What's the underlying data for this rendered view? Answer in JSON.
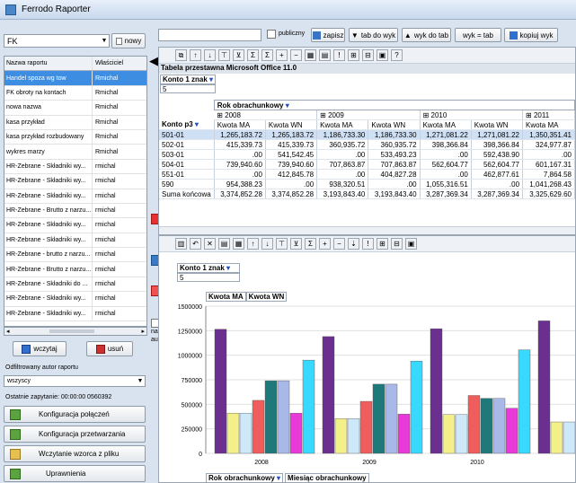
{
  "app": {
    "title": "Ferrodo Raporter"
  },
  "left": {
    "filter_value": "FK",
    "new_button": "nowy",
    "table": {
      "headers": [
        "Nazwa raportu",
        "Właściciel"
      ],
      "rows": [
        [
          "Handel spoza wg tow",
          "Rmichal"
        ],
        [
          "FK obroty na kontach",
          "Rmichal"
        ],
        [
          "nowa nazwa",
          "Rmichal"
        ],
        [
          "kasa przykład",
          "Rmichal"
        ],
        [
          "kasa przykład rozbudowany",
          "Rmichal"
        ],
        [
          "wykres marzy",
          "Rmichal"
        ],
        [
          "HR-Zebrane - Składniki wy...",
          "rmichal"
        ],
        [
          "HR-Zebrane - Składniki wy...",
          "rmichal"
        ],
        [
          "HR-Zebrane - Składniki wy...",
          "rmichal"
        ],
        [
          "HR-Zebrane - Brutto z narzu...",
          "rmichal"
        ],
        [
          "HR-Zebrane - Składniki wy...",
          "rmichal"
        ],
        [
          "HR-Zebrane - Składniki wy...",
          "rmichal"
        ],
        [
          "HR-Zebrane - brutto z narzu...",
          "rmichal"
        ],
        [
          "HR-Zebrane - Brutto z narzu...",
          "rmichal"
        ],
        [
          "HR-Zebrane - Składniki do ...",
          "rmichal"
        ],
        [
          "HR-Zebrane - Składniki wy...",
          "rmichal"
        ],
        [
          "HR-Zebrane - Składniki wy...",
          "rmichal"
        ]
      ]
    },
    "load_button": "wczytaj",
    "delete_button": "usuń",
    "filter_author_label": "Odfiltrowany autor raportu",
    "author_value": "wszyscy",
    "last_query": "Ostatnie zapytanie: 00:00:00 0560392",
    "buttons": [
      "Konfiguracja połączeń",
      "Konfiguracja przetwarzania",
      "Wczytanie wzorca z pliku",
      "Uprawnienia"
    ]
  },
  "side": {
    "nag_label": "nag",
    "auto_label": "auto"
  },
  "toolbar": {
    "publiczny": "publiczny",
    "zapisz": "zapisz",
    "tab_do_wyk": "tab do wyk",
    "wyk_do_tab": "wyk do tab",
    "wyk_tab": "wyk = tab",
    "kopiuj_wyk": "kopiuj wyk"
  },
  "pivot": {
    "title": "Tabela przestawna Microsoft Office 11.0",
    "konto1": "Konto 1 znak",
    "konto1_val": "5",
    "rok_header": "Rok obrachunkowy",
    "konto3_label": "Konto p3",
    "years": [
      "⊞ 2008",
      "⊞ 2009",
      "⊞ 2010",
      "⊞ 2011"
    ],
    "measures": [
      "Kwota MA",
      "Kwota WN",
      "Kwota MA",
      "Kwota WN",
      "Kwota MA",
      "Kwota WN",
      "Kwota MA"
    ],
    "rows": [
      {
        "k": "501-01",
        "v": [
          "1,265,183.72",
          "1,265,183.72",
          "1,186,733.30",
          "1,186,733.30",
          "1,271,081.22",
          "1,271,081.22",
          "1,350,351.41"
        ]
      },
      {
        "k": "502-01",
        "v": [
          "415,339.73",
          "415,339.73",
          "360,935.72",
          "360,935.72",
          "398,366.84",
          "398,366.84",
          "324,977.87"
        ]
      },
      {
        "k": "503-01",
        "v": [
          ".00",
          "541,542.45",
          ".00",
          "533,493.23",
          ".00",
          "592,438.90",
          ".00"
        ]
      },
      {
        "k": "504-01",
        "v": [
          "739,940.60",
          "739,940.60",
          "707,863.87",
          "707,863.87",
          "562,604.77",
          "562,604.77",
          "601,167.31"
        ]
      },
      {
        "k": "551-01",
        "v": [
          ".00",
          "412,845.78",
          ".00",
          "404,827.28",
          ".00",
          "462,877.61",
          "7,864.58"
        ]
      },
      {
        "k": "590",
        "v": [
          "954,388.23",
          ".00",
          "938,320.51",
          ".00",
          "1,055,316.51",
          ".00",
          "1,041,268.43"
        ]
      },
      {
        "k": "Suma końcowa",
        "v": [
          "3,374,852.28",
          "3,374,852.28",
          "3,193,843.40",
          "3,193,843.40",
          "3,287,369.34",
          "3,287,369.34",
          "3,325,629.60"
        ]
      }
    ]
  },
  "chart_data": {
    "type": "bar",
    "categories": [
      "2008",
      "2009",
      "2010"
    ],
    "yticks": [
      "0",
      "250000",
      "500000",
      "750000",
      "1000000",
      "1250000",
      "1500000"
    ],
    "ylim": [
      0,
      1500000
    ],
    "filter_label": "Konto 1 znak",
    "filter_value": "5",
    "legend_fields": [
      "Kwota MA",
      "Kwota WN"
    ],
    "xaxis_fields": [
      "Rok obrachunkowy",
      "Miesiąc obrachunkowy"
    ],
    "series_colors": [
      "#6b2f8f",
      "#f3f08a",
      "#cde8f8",
      "#f05d5d",
      "#1e7a7a",
      "#a8b8e8",
      "#e83ad8",
      "#38d8ff",
      "#4a4fe8",
      "#800040"
    ],
    "groups": [
      {
        "values": [
          1265000,
          410000,
          410000,
          540000,
          740000,
          740000,
          410000,
          950000
        ]
      },
      {
        "values": [
          1190000,
          355000,
          355000,
          530000,
          705000,
          705000,
          400000,
          940000
        ]
      },
      {
        "values": [
          1270000,
          395000,
          395000,
          590000,
          560000,
          560000,
          460000,
          1055000
        ]
      },
      {
        "values": [
          1350000,
          320000,
          320000
        ]
      }
    ]
  }
}
